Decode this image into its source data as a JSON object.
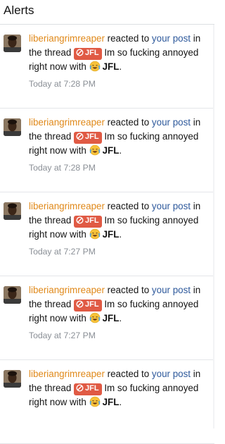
{
  "header": {
    "title": "Alerts"
  },
  "alerts": [
    {
      "user": "liberiangrimreaper",
      "action": " reacted to ",
      "link1": "your",
      "link2": "post",
      "mid": " in the thread ",
      "prefix": "JFL",
      "thread": " Im so fucking annoyed right now with ",
      "reaction": "JFL",
      "period": ".",
      "time": "Today at 7:28 PM"
    },
    {
      "user": "liberiangrimreaper",
      "action": " reacted to ",
      "link1": "your",
      "link2": "post",
      "mid": " in the thread ",
      "prefix": "JFL",
      "thread": " Im so fucking annoyed right now with ",
      "reaction": "JFL",
      "period": ".",
      "time": "Today at 7:28 PM"
    },
    {
      "user": "liberiangrimreaper",
      "action": " reacted to ",
      "link1": "your",
      "link2": "post",
      "mid": " in the thread ",
      "prefix": "JFL",
      "thread": " Im so fucking annoyed right now with ",
      "reaction": "JFL",
      "period": ".",
      "time": "Today at 7:27 PM"
    },
    {
      "user": "liberiangrimreaper",
      "action": " reacted to ",
      "link1": "your",
      "link2": "post",
      "mid": " in the thread ",
      "prefix": "JFL",
      "thread": " Im so fucking annoyed right now with ",
      "reaction": "JFL",
      "period": ".",
      "time": "Today at 7:27 PM"
    },
    {
      "user": "liberiangrimreaper",
      "action": " reacted to ",
      "link1": "your",
      "link2": "post",
      "mid": " in the thread ",
      "prefix": "JFL",
      "thread": " Im so fucking annoyed right now with ",
      "reaction": "JFL",
      "period": ".",
      "time": ""
    }
  ],
  "icons": {
    "avatar": "user-avatar",
    "prefix_icon": "slash-circle-icon",
    "reaction_emoji": "crying-laughing-emoji-icon"
  },
  "colors": {
    "username": "#e0891a",
    "link": "#2f5a9c",
    "prefix_badge": "#e05a44",
    "timestamp": "#8a8f96"
  }
}
